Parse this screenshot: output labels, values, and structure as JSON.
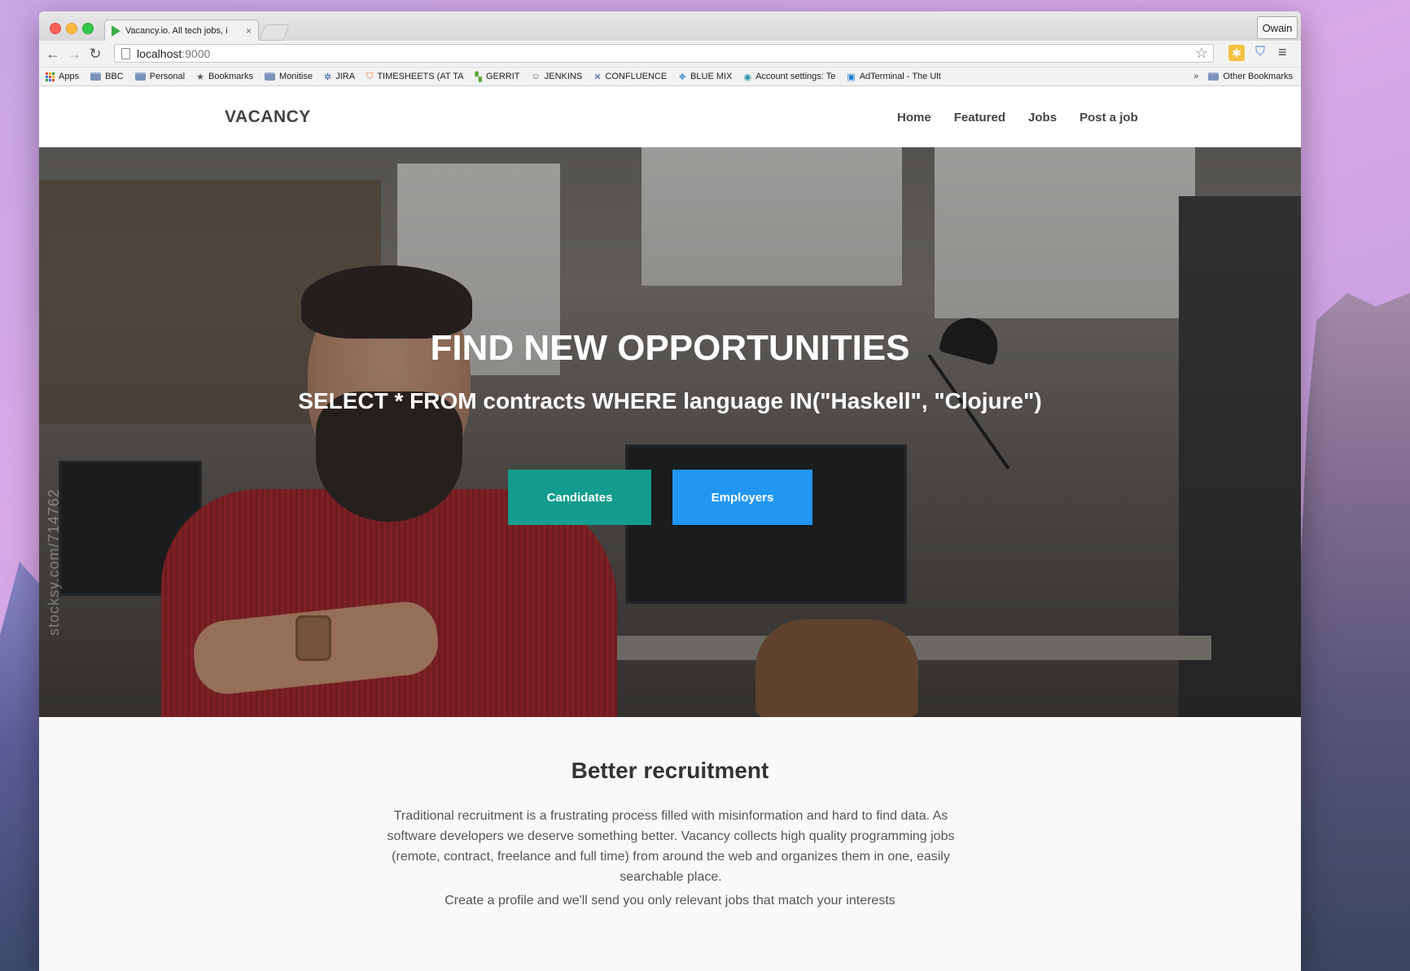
{
  "desktop": {
    "user_button": "Owain"
  },
  "browser": {
    "tab": {
      "title": "Vacancy.io. All tech jobs, i",
      "close": "×"
    },
    "url": {
      "host": "localhost",
      "port": ":9000"
    },
    "bookmarks": [
      {
        "label": "Apps",
        "icon": "apps-grid-icon"
      },
      {
        "label": "BBC",
        "icon": "folder-icon"
      },
      {
        "label": "Personal",
        "icon": "folder-icon"
      },
      {
        "label": "Bookmarks",
        "icon": "star-icon"
      },
      {
        "label": "Monitise",
        "icon": "folder-icon"
      },
      {
        "label": "JIRA",
        "icon": "jira-icon"
      },
      {
        "label": "TIMESHEETS (AT TA",
        "icon": "timesheets-icon"
      },
      {
        "label": "GERRIT",
        "icon": "gerrit-icon"
      },
      {
        "label": "JENKINS",
        "icon": "jenkins-icon"
      },
      {
        "label": "CONFLUENCE",
        "icon": "confluence-icon"
      },
      {
        "label": "BLUE MIX",
        "icon": "bluemix-icon"
      },
      {
        "label": "Account settings: Te",
        "icon": "account-icon"
      },
      {
        "label": "AdTerminal - The Ult",
        "icon": "adterminal-icon"
      }
    ],
    "overflow": "»",
    "other_bookmarks": "Other Bookmarks"
  },
  "site": {
    "brand": "VACANCY",
    "nav": [
      "Home",
      "Featured",
      "Jobs",
      "Post a job"
    ],
    "hero": {
      "title": "FIND NEW OPPORTUNITIES",
      "subtitle": "SELECT * FROM contracts WHERE language IN(\"Haskell\", \"Clojure\")",
      "candidates_button": "Candidates",
      "employers_button": "Employers",
      "watermark": "stocksy.com/714762"
    },
    "about": {
      "title": "Better recruitment",
      "body": "Traditional recruitment is a frustrating process filled with misinformation and hard to find data. As software developers we deserve something better. Vacancy collects high quality programming jobs (remote, contract, freelance and full time) from around the web and organizes them in one, easily searchable place.",
      "cta": "Create a profile and we'll send you only relevant jobs that match your interests"
    }
  },
  "colors": {
    "candidates": "#139c8e",
    "employers": "#2196f3"
  }
}
